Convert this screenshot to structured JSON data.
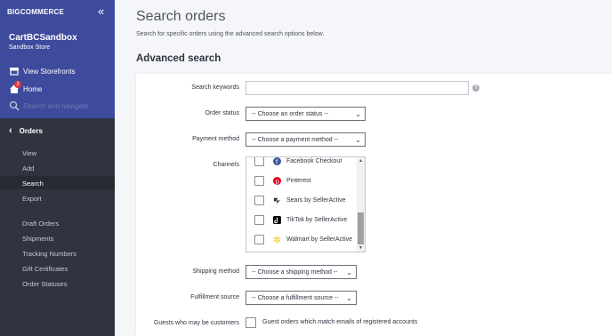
{
  "sidebar": {
    "logo": "BIGCOMMERCE",
    "store_name": "CartBCSandbox",
    "store_sub": "Sandbox Store",
    "links": [
      {
        "label": "View Storefronts",
        "icon": "storefront-icon"
      },
      {
        "label": "Home",
        "icon": "home-icon",
        "badge": "2"
      },
      {
        "label": "Search and navigate",
        "icon": "search-icon"
      }
    ],
    "section": "Orders",
    "sub_items": [
      "View",
      "Add",
      "Search",
      "Export"
    ],
    "more_items": [
      "Draft Orders",
      "Shipments",
      "Tracking Numbers",
      "Gift Certificates",
      "Order Statuses"
    ],
    "active_item": "Search"
  },
  "main": {
    "title": "Search orders",
    "description": "Search for specific orders using the advanced search options below.",
    "section_title": "Advanced search"
  },
  "form": {
    "keywords_label": "Search keywords",
    "keywords_value": "",
    "order_status_label": "Order status",
    "order_status_value": "-- Choose an order status --",
    "payment_label": "Payment method",
    "payment_value": "-- Choose a payment method --",
    "channels_label": "Channels",
    "channels": [
      {
        "label": "Facebook Checkout",
        "icon": "facebook-icon",
        "color": "#3b5998"
      },
      {
        "label": "Pinterest",
        "icon": "pinterest-icon",
        "color": "#e60023"
      },
      {
        "label": "Sears by SellerActive",
        "icon": "selleractive-icon",
        "color": "#313440"
      },
      {
        "label": "TikTok by SellerActive",
        "icon": "tiktok-icon",
        "color": "#000000"
      },
      {
        "label": "Walmart by SellerActive",
        "icon": "walmart-icon",
        "color": "#ffc220"
      }
    ],
    "shipping_label": "Shipping method",
    "shipping_value": "-- Choose a shipping method --",
    "fulfillment_label": "Fulfillment source",
    "fulfillment_value": "-- Choose a fulfillment source --",
    "guests_label": "Guests who may be customers",
    "guests_check_label": "Guest orders which match emails of registered accounts"
  },
  "colors": {
    "sidebar_top": "#3e4a9c",
    "sidebar": "#303440",
    "accent": "#3c64f4"
  }
}
